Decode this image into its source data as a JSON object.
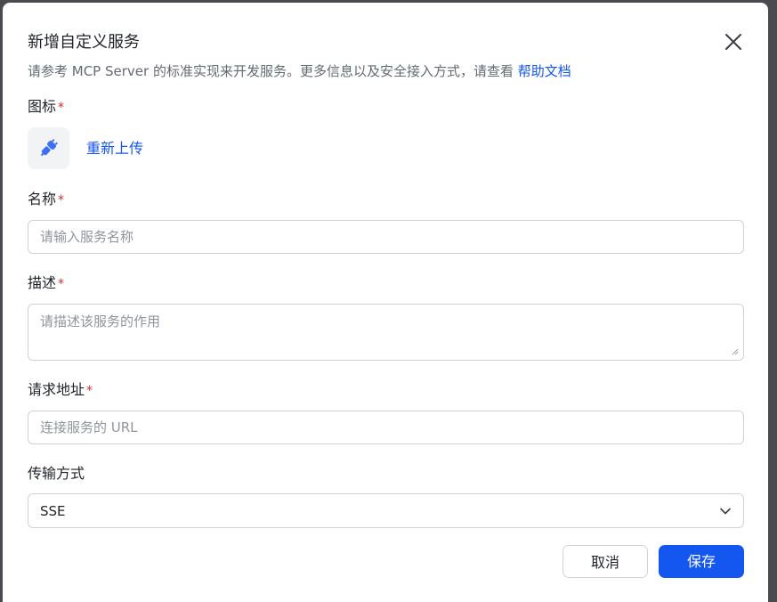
{
  "dialog": {
    "title": "新增自定义服务",
    "subtitle_text": "请参考 MCP Server 的标准实现来开发服务。更多信息以及安全接入方式，请查看",
    "subtitle_link": "帮助文档"
  },
  "form": {
    "icon": {
      "label": "图标",
      "required_mark": "*",
      "reupload_label": "重新上传",
      "icon_name": "plug-icon"
    },
    "name": {
      "label": "名称",
      "required_mark": "*",
      "placeholder": "请输入服务名称",
      "value": ""
    },
    "description": {
      "label": "描述",
      "required_mark": "*",
      "placeholder": "请描述该服务的作用",
      "value": ""
    },
    "url": {
      "label": "请求地址",
      "required_mark": "*",
      "placeholder": "连接服务的 URL",
      "value": ""
    },
    "transport": {
      "label": "传输方式",
      "selected": "SSE"
    }
  },
  "footer": {
    "cancel_label": "取消",
    "save_label": "保存"
  },
  "colors": {
    "primary": "#1456f0",
    "required": "#e02d2d",
    "text": "#1f2329",
    "placeholder": "#8f959e",
    "border": "#d0d3d6"
  }
}
